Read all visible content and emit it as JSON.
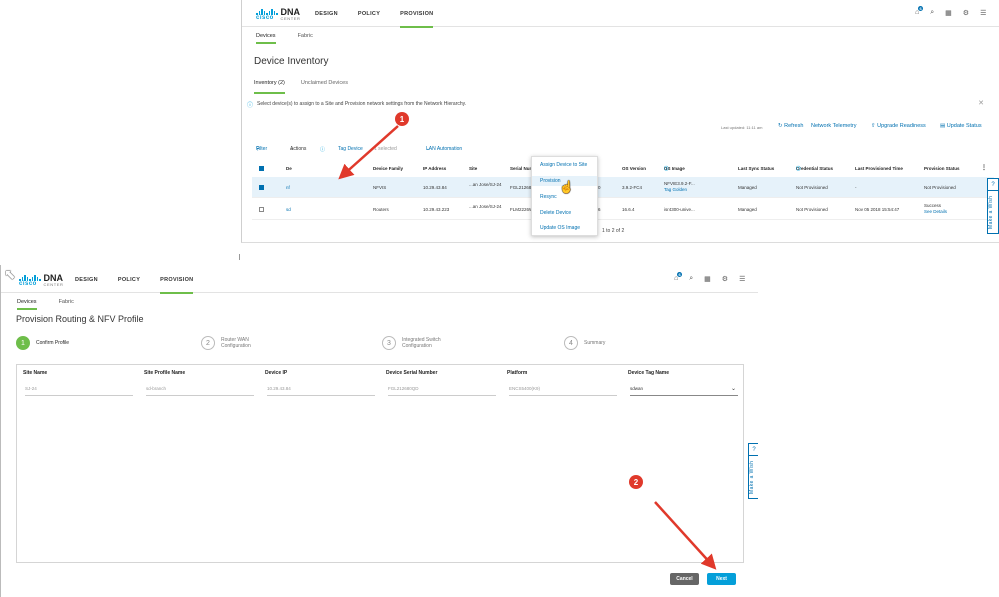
{
  "top": {
    "logo": {
      "cisco": "cisco",
      "dna": "DNA",
      "center": "CENTER"
    },
    "nav": [
      "DESIGN",
      "POLICY",
      "PROVISION"
    ],
    "notifications_count": "6",
    "subtabs": [
      "Devices",
      "Fabric"
    ],
    "title": "Device Inventory",
    "inventory_tab": "Inventory  (2)",
    "unclaimed_tab": "Unclaimed Devices",
    "info_text": "Select device(s) to assign to a Site and Provision network settings from the Network Hierarchy.",
    "last_updated": "Last updated: 11:11 am",
    "refresh": "Refresh",
    "network_telemetry": "Network Telemetry",
    "upgrade_readiness": "Upgrade Readiness",
    "update_status": "Update Status",
    "filter": "Filter",
    "actions": "Actions",
    "tag_device": "Tag Device",
    "selected": "1 selected",
    "lan_automation": "LAN Automation",
    "columns": [
      "De",
      "Device Family",
      "IP Address",
      "Site",
      "Serial Number",
      "Uptime",
      "OS Version",
      "OS Image",
      "Last Sync Status",
      "Credential Status",
      "Last Provisioned Time",
      "Provision Status"
    ],
    "rows": [
      {
        "name": "nf",
        "family": "NFVIS",
        "ip": "10.29.43.84",
        "site": "...an Jose/SJ-24",
        "serial": "FGL212680QD",
        "uptime": "21 days, 8:35:05.00",
        "os_version": "3.9.2-FC4",
        "os_image": "NFVIE3.9.2-F...",
        "os_image_sub": "Tag Golden",
        "sync": "Managed",
        "cred": "Not Provisioned",
        "last_prov": "-",
        "prov": "Not Provisioned",
        "prov_sub": ""
      },
      {
        "name": "sd",
        "family": "Routers",
        "ip": "10.29.43.223",
        "site": "...an Jose/SJ-24",
        "serial": "FLM2226W0ZQ",
        "uptime": "41 days, 2:04:57.46",
        "os_version": "16.6.4",
        "os_image": "isr4300-unive...",
        "os_image_sub": "",
        "sync": "Managed",
        "cred": "Not Provisioned",
        "last_prov": "Nov 05 2018 15:54:47",
        "prov": "Success",
        "prov_sub": "See Details"
      }
    ],
    "pager": "1 to 2 of 2",
    "menu": [
      "Assign Device to Site",
      "Provision",
      "Resync",
      "Delete Device",
      "Update OS Image"
    ],
    "side": {
      "q": "?",
      "label": "Make a Wish"
    }
  },
  "bottom": {
    "logo": {
      "cisco": "cisco",
      "dna": "DNA",
      "center": "CENTER"
    },
    "nav": [
      "DESIGN",
      "POLICY",
      "PROVISION"
    ],
    "notifications_count": "6",
    "subtabs": [
      "Devices",
      "Fabric"
    ],
    "title": "Provision Routing & NFV Profile",
    "steps": [
      {
        "n": "1",
        "label": "Confirm Profile"
      },
      {
        "n": "2",
        "label": "Router WAN",
        "label2": "Configuration"
      },
      {
        "n": "3",
        "label": "Integrated Switch",
        "label2": "Configuration"
      },
      {
        "n": "4",
        "label": "Summary"
      }
    ],
    "fields": [
      {
        "label": "Site Name",
        "value": "SJ-24"
      },
      {
        "label": "Site Profile Name",
        "value": "sd-branch"
      },
      {
        "label": "Device IP",
        "value": "10.29.43.84"
      },
      {
        "label": "Device Serial Number",
        "value": "FGL212680QD"
      },
      {
        "label": "Platform",
        "value": "ENCS5400(K9)"
      },
      {
        "label": "Device Tag Name",
        "value": "sdwan"
      }
    ],
    "cancel": "Cancel",
    "next": "Next",
    "side": {
      "q": "?",
      "label": "Make a Wish"
    }
  },
  "markers": [
    "1",
    "2"
  ],
  "colors": {
    "accent": "#049fd9",
    "green": "#6ebe4a",
    "annotation": "#e0392b",
    "link": "#0070b0"
  }
}
